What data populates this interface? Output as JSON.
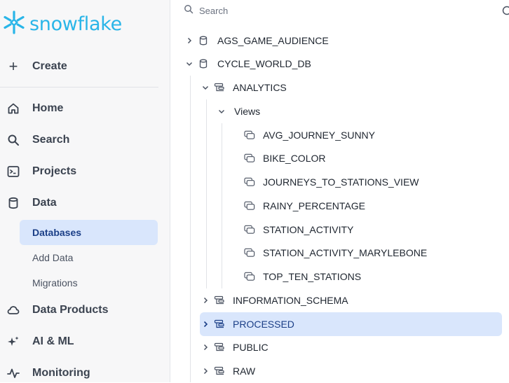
{
  "brand": {
    "name": "snowflake",
    "color": "#29b5e8"
  },
  "sidebar": {
    "create_label": "Create",
    "nav": [
      {
        "label": "Home",
        "icon": "home-icon"
      },
      {
        "label": "Search",
        "icon": "search-icon"
      },
      {
        "label": "Projects",
        "icon": "terminal-icon"
      },
      {
        "label": "Data",
        "icon": "database-icon"
      },
      {
        "label": "Data Products",
        "icon": "cloud-icon"
      },
      {
        "label": "AI & ML",
        "icon": "sparkle-icon"
      },
      {
        "label": "Monitoring",
        "icon": "activity-icon"
      }
    ],
    "data_sub": [
      {
        "label": "Databases",
        "active": true
      },
      {
        "label": "Add Data",
        "active": false
      },
      {
        "label": "Migrations",
        "active": false
      }
    ]
  },
  "search": {
    "placeholder": "Search"
  },
  "tree": {
    "databases": [
      {
        "label": "AGS_GAME_AUDIENCE",
        "expanded": false
      },
      {
        "label": "CYCLE_WORLD_DB",
        "expanded": true
      }
    ],
    "schemas": [
      {
        "label": "ANALYTICS",
        "expanded": true
      },
      {
        "label": "INFORMATION_SCHEMA",
        "expanded": false
      },
      {
        "label": "PROCESSED",
        "expanded": false,
        "selected": true
      },
      {
        "label": "PUBLIC",
        "expanded": false
      },
      {
        "label": "RAW",
        "expanded": false
      }
    ],
    "views_folder": {
      "label": "Views",
      "expanded": true
    },
    "views": [
      "AVG_JOURNEY_SUNNY",
      "BIKE_COLOR",
      "JOURNEYS_TO_STATIONS_VIEW",
      "RAINY_PERCENTAGE",
      "STATION_ACTIVITY",
      "STATION_ACTIVITY_MARYLEBONE",
      "TOP_TEN_STATIONS"
    ]
  }
}
